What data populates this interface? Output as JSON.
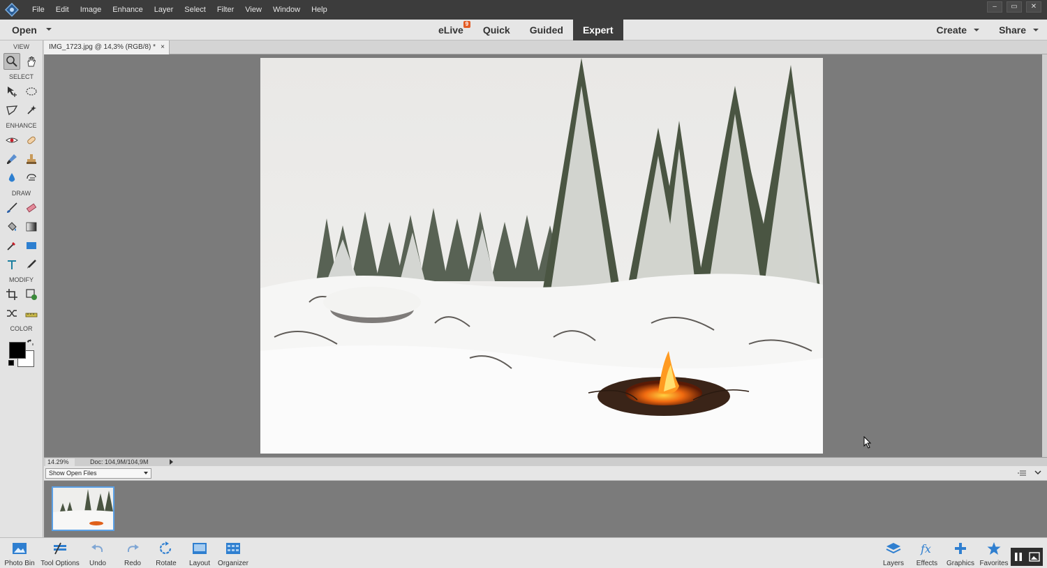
{
  "menu": {
    "items": [
      "File",
      "Edit",
      "Image",
      "Enhance",
      "Layer",
      "Select",
      "Filter",
      "View",
      "Window",
      "Help"
    ],
    "window_controls": [
      "–",
      "▭",
      "✕"
    ]
  },
  "modebar": {
    "open_label": "Open",
    "modes": [
      {
        "label": "eLive",
        "badge": "9"
      },
      {
        "label": "Quick"
      },
      {
        "label": "Guided"
      },
      {
        "label": "Expert",
        "active": true
      }
    ],
    "create_label": "Create",
    "share_label": "Share"
  },
  "toolbox": {
    "sections": {
      "view": "VIEW",
      "select": "SELECT",
      "enhance": "ENHANCE",
      "draw": "DRAW",
      "modify": "MODIFY",
      "color": "COLOR"
    },
    "foreground_color": "#000000",
    "background_color": "#ffffff"
  },
  "document": {
    "tab_title": "IMG_1723.jpg @ 14,3% (RGB/8) *",
    "tab_close": "×",
    "zoom": "14.29%",
    "doc_info": "Doc: 104,9M/104,9M"
  },
  "photo_bin": {
    "dropdown_value": "Show Open Files"
  },
  "taskbar": {
    "left": [
      "Photo Bin",
      "Tool Options",
      "Undo",
      "Redo",
      "Rotate",
      "Layout",
      "Organizer"
    ],
    "right": [
      "Layers",
      "Effects",
      "Graphics",
      "Favorites"
    ]
  },
  "colors": {
    "accent": "#1d6fc4",
    "menubar": "#3c3c3c",
    "active_mode": "#3d3d3d",
    "badge": "#e35b24"
  }
}
